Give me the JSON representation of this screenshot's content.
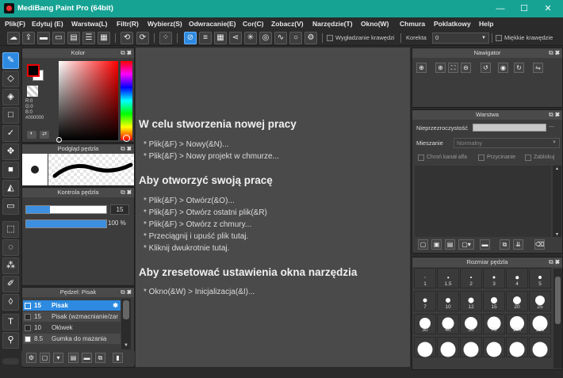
{
  "app": {
    "title": "MediBang Paint Pro (64bit)"
  },
  "window_controls": {
    "minimize": "—",
    "maximize": "☐",
    "close": "✕"
  },
  "menu": [
    "Plik(F)",
    "Edytuj (E)",
    "Warstwa(L)",
    "Filtr(R)",
    "Wybierz(S)",
    "Odwracanie(E)",
    "Cor(C)",
    "Zobacz(V)",
    "Narzędzie(T)",
    "Okno(W)",
    "Chmura",
    "Poklatkowy",
    "Help"
  ],
  "toolbar": {
    "antialias_label": "Wygładzanie krawędzi",
    "correction_label": "Korekta",
    "correction_value": "0",
    "soft_edges_label": "Miękkie krawędzie"
  },
  "color_panel": {
    "title": "Kolor",
    "r": "R:0",
    "g": "G:0",
    "b": "B:0",
    "hex": "#000000",
    "fg_color": "#000000",
    "bg_color": "#ffffff"
  },
  "brush_preview": {
    "title": "Podgląd pędzla"
  },
  "brush_control": {
    "title": "Kontrola pędzla",
    "size_value": "15",
    "opacity_value": "100 %"
  },
  "brush_list": {
    "title": "Pędzel: Pisak",
    "items": [
      {
        "size": "15",
        "name": "Pisak"
      },
      {
        "size": "15",
        "name": "Pisak (wzmacnianie/zar"
      },
      {
        "size": "10",
        "name": "Ołówek"
      },
      {
        "size": "8.5",
        "name": "Gumka do mazania"
      }
    ]
  },
  "canvas": {
    "heading_new": "W celu stworzenia nowej pracy",
    "new_items": [
      "* Plik(&F) > Nowy(&N)...",
      "* Plik(&F) > Nowy projekt w chmurze..."
    ],
    "heading_open": "Aby otworzyć swoją pracę",
    "open_items": [
      "* Plik(&F) > Otwórz(&O)...",
      "* Plik(&F) > Otwórz ostatni plik(&R)",
      "* Plik(&F) > Otwórz z chmury...",
      "* Przeciągnij i upuść plik tutaj.",
      "* Kliknij dwukrotnie tutaj."
    ],
    "heading_reset": "Aby zresetować ustawienia okna narzędzia",
    "reset_items": [
      "* Okno(&W) > Inicjalizacja(&I)..."
    ]
  },
  "navigator": {
    "title": "Nawigator"
  },
  "layer_panel": {
    "title": "Warstwa",
    "opacity_label": "Nieprzezroczystość",
    "opacity_value": "---",
    "blend_label": "Mieszanie",
    "blend_value": "Normalny",
    "protect_alpha": "Chroń kanał alfa",
    "clipping": "Przycinanie",
    "lock": "Zablokuj"
  },
  "brush_size_panel": {
    "title": "Rozmiar pędzla",
    "sizes": [
      "1",
      "1.5",
      "2",
      "3",
      "4",
      "5",
      "7",
      "10",
      "12",
      "15",
      "20",
      "25",
      "30",
      "40",
      "50",
      "70",
      "100",
      "150",
      "",
      "",
      "",
      "",
      "",
      ""
    ]
  }
}
